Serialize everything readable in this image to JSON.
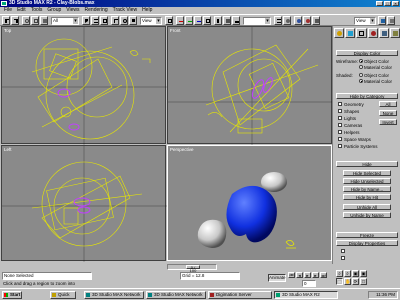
{
  "window": {
    "title": "3D Studio MAX R2 - Clay-Blobs.max"
  },
  "menu": [
    "File",
    "Edit",
    "Tools",
    "Group",
    "Views",
    "Rendering",
    "Track View",
    "Help"
  ],
  "toolbar": {
    "selection_filter": "All",
    "ref_coord": "View",
    "named_selection": "",
    "view_filter": "View"
  },
  "viewports": [
    {
      "label": "Top"
    },
    {
      "label": "Front"
    },
    {
      "label": "Left"
    },
    {
      "label": "Perspective"
    }
  ],
  "command_panel": {
    "display_color_btn": "Display Color",
    "wireframe_label": "Wireframe:",
    "object_color": "Object Color",
    "material_color": "Material Color",
    "shaded_label": "Shaded:",
    "hide_by_category_btn": "Hide by Category",
    "categories": [
      "Geometry",
      "Shapes",
      "Lights",
      "Cameras",
      "Helpers",
      "Space Warps",
      "Particle Systems"
    ],
    "all_btn": "All",
    "none_btn": "None",
    "invert_btn": "Invert",
    "hide_btn": "Hide",
    "hide_buttons": [
      "Hide Selected",
      "Hide Unselected",
      "Hide by Name...",
      "Hide by Hit"
    ],
    "unhide_buttons": [
      "Unhide All",
      "Unhide by Name"
    ],
    "freeze_btn": "Freeze",
    "display_props_btn": "Display Properties"
  },
  "status": {
    "time_slider": "0 / 100",
    "selection": "None Selected",
    "grid": "Grid = 12.8",
    "prompt": "Click and drag a region to zoom into",
    "animate": "Animate",
    "frame": "0"
  },
  "taskbar": {
    "start": "Start",
    "tasks": [
      "Quick",
      "3D Studio MAX Network",
      "3D Studio MAX Network",
      "Digimation Server",
      "3D Studio MAX R2"
    ],
    "clock": "11:36 PM"
  },
  "colors": {
    "wire": "#e8e800",
    "selected": "#c040ff",
    "blob": "#1030e0",
    "viewport_bg": "#8a8a8a"
  }
}
